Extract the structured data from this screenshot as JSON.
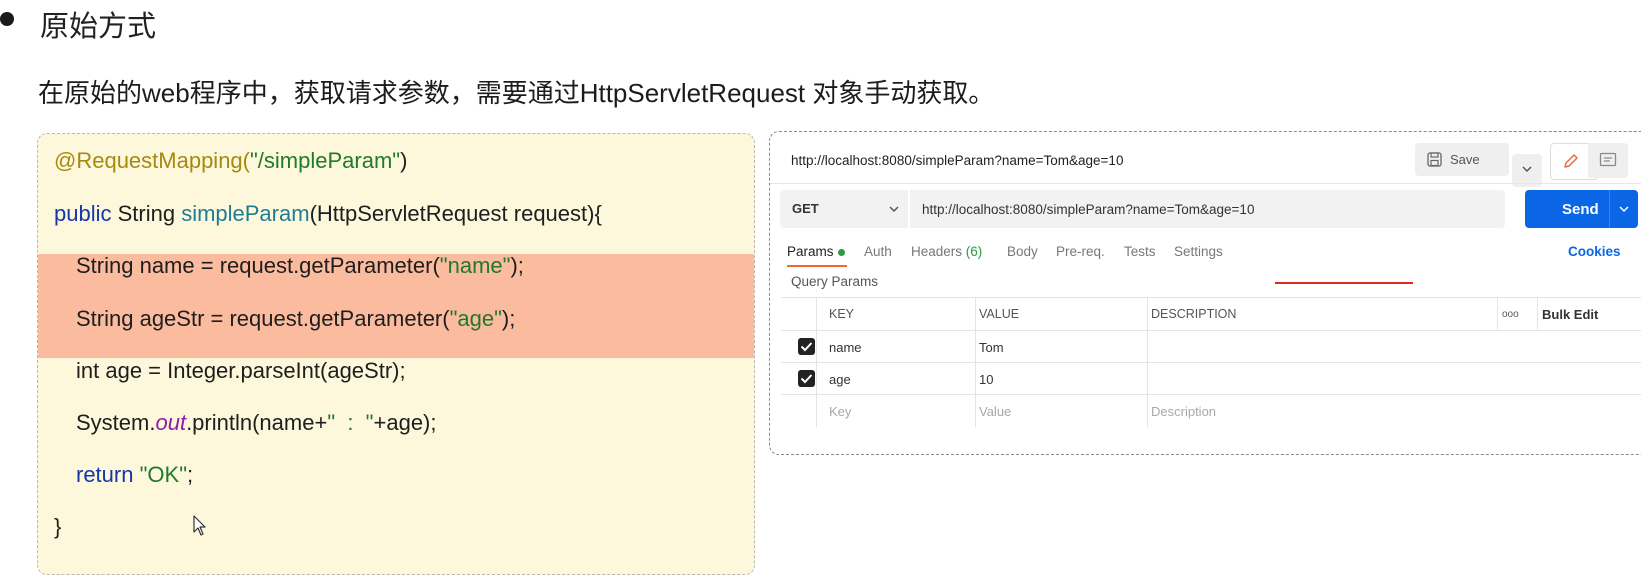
{
  "slide": {
    "heading": "原始方式",
    "intro": "在原始的web程序中，获取请求参数，需要通过HttpServletRequest 对象手动获取。"
  },
  "code": {
    "l1_ann": "@RequestMapping(",
    "l1_str": "\"/simpleParam\"",
    "l1_end": ")",
    "l2_kw": "public",
    "l2_mid": " String ",
    "l2_fn": "simpleParam",
    "l2_end": "(HttpServletRequest request){",
    "l3_a": "String name = request.getParameter(",
    "l3_str": "\"name\"",
    "l3_end": ");",
    "l4_a": "String ageStr = request.getParameter(",
    "l4_str": "\"age\"",
    "l4_end": ");",
    "l5": "int age = Integer.parseInt(ageStr);",
    "l6_a": "System.",
    "l6_out": "out",
    "l6_b": ".println(name+",
    "l6_str": "\"  :  \"",
    "l6_end": "+age);",
    "l7_kw": "return ",
    "l7_str": "\"OK\"",
    "l7_end": ";",
    "l8": "}"
  },
  "postman": {
    "title_url": "http://localhost:8080/simpleParam?name=Tom&age=10",
    "save_label": "Save",
    "method": "GET",
    "url_value": "http://localhost:8080/simpleParam?name=Tom&age=10",
    "send_label": "Send",
    "tabs": {
      "params": "Params",
      "auth": "Auth",
      "headers": "Headers",
      "headers_count": "(6)",
      "body": "Body",
      "prereq": "Pre-req.",
      "tests": "Tests",
      "settings": "Settings"
    },
    "cookies": "Cookies",
    "query_params": "Query Params",
    "table": {
      "col_key": "KEY",
      "col_value": "VALUE",
      "col_desc": "DESCRIPTION",
      "more": "ooo",
      "bulk_edit": "Bulk Edit",
      "rows": [
        {
          "key": "name",
          "value": "Tom"
        },
        {
          "key": "age",
          "value": "10"
        }
      ],
      "placeholder_key": "Key",
      "placeholder_value": "Value",
      "placeholder_desc": "Description"
    },
    "colors": {
      "send": "#0a66e4",
      "underline": "#e0281b",
      "active_tab": "#f06a2b"
    }
  }
}
